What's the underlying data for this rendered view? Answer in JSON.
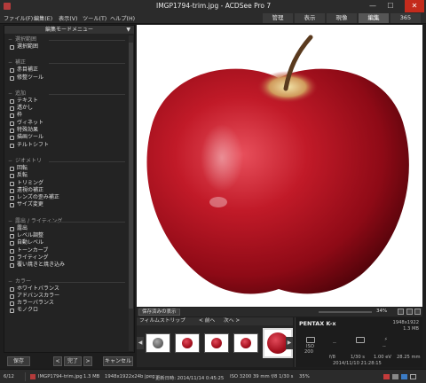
{
  "window": {
    "title": "IMGP1794-trim.jpg - ACDSee Pro 7",
    "minimize": "—",
    "maximize": "☐",
    "close": "✕"
  },
  "menu": [
    "ファイル(F)",
    "編集(E)",
    "表示(V)",
    "ツール(T)",
    "ヘルプ(H)"
  ],
  "modes": [
    {
      "label": "管理",
      "active": false
    },
    {
      "label": "表示",
      "active": false
    },
    {
      "label": "現像",
      "active": false
    },
    {
      "label": "編集",
      "active": true
    },
    {
      "label": "365",
      "active": false
    }
  ],
  "left_panel": {
    "header": "編集モードメニュー",
    "groups": [
      {
        "title": "選択範囲",
        "items": [
          "選択範囲"
        ]
      },
      {
        "title": "補正",
        "items": [
          "赤目補正",
          "修整ツール"
        ]
      },
      {
        "title": "追加",
        "items": [
          "テキスト",
          "透かし",
          "枠",
          "ヴィネット",
          "特殊効果",
          "描画ツール",
          "チルトシフト"
        ]
      },
      {
        "title": "ジオメトリ",
        "items": [
          "回転",
          "反転",
          "トリミング",
          "遠視の補正",
          "レンズの歪み補正",
          "サイズ変更"
        ]
      },
      {
        "title": "露出 / ライティング",
        "items": [
          "露出",
          "レベル調整",
          "自動レベル",
          "トーンカーブ",
          "ライティング",
          "覆い焼きと焼き込み"
        ]
      },
      {
        "title": "カラー",
        "items": [
          "ホワイトバランス",
          "アドバンスカラー",
          "カラーバランス",
          "モノクロ"
        ]
      }
    ],
    "footer": {
      "save": "保存",
      "done": "完了",
      "cancel": "キャンセル",
      "prev": "<",
      "next": ">"
    }
  },
  "viewer_toolbar": {
    "save_button": "保存済みの表示",
    "zoom": "34%"
  },
  "filmstrip": {
    "title": "フィルムストリップ",
    "prev": "< 前へ",
    "next": "次へ >",
    "thumbs": [
      {
        "selected": false,
        "gray": true
      },
      {
        "selected": false,
        "gray": false
      },
      {
        "selected": false,
        "gray": false
      },
      {
        "selected": false,
        "gray": false
      },
      {
        "selected": true,
        "gray": false
      }
    ]
  },
  "info_panel": {
    "camera": "PENTAX K-x",
    "resolution": "1948x1922",
    "size": "1.3 MB",
    "iso_label": "ISO",
    "iso_value": "200",
    "metering": "--",
    "flash": "--",
    "aperture": "f/8",
    "shutter": "1/30 s",
    "ev": "1.00 eV",
    "focal": "28.25 mm",
    "datetime": "2014/11/10 21:28:15"
  },
  "status": {
    "index": "6/12",
    "filename": "IMGP1794-trim.jpg",
    "filesize": "1.3 MB",
    "dims": "1948x1922x24b jpeg",
    "modified": "更新日時: 2014/11/14 0:45:25",
    "exposure": "ISO 3200  39 mm  f/8  1/30 s",
    "zoom": "35%"
  },
  "colors": {
    "accent": "#c42b1c",
    "apple_red": "#b0141e",
    "background": "#1e1e1e"
  }
}
